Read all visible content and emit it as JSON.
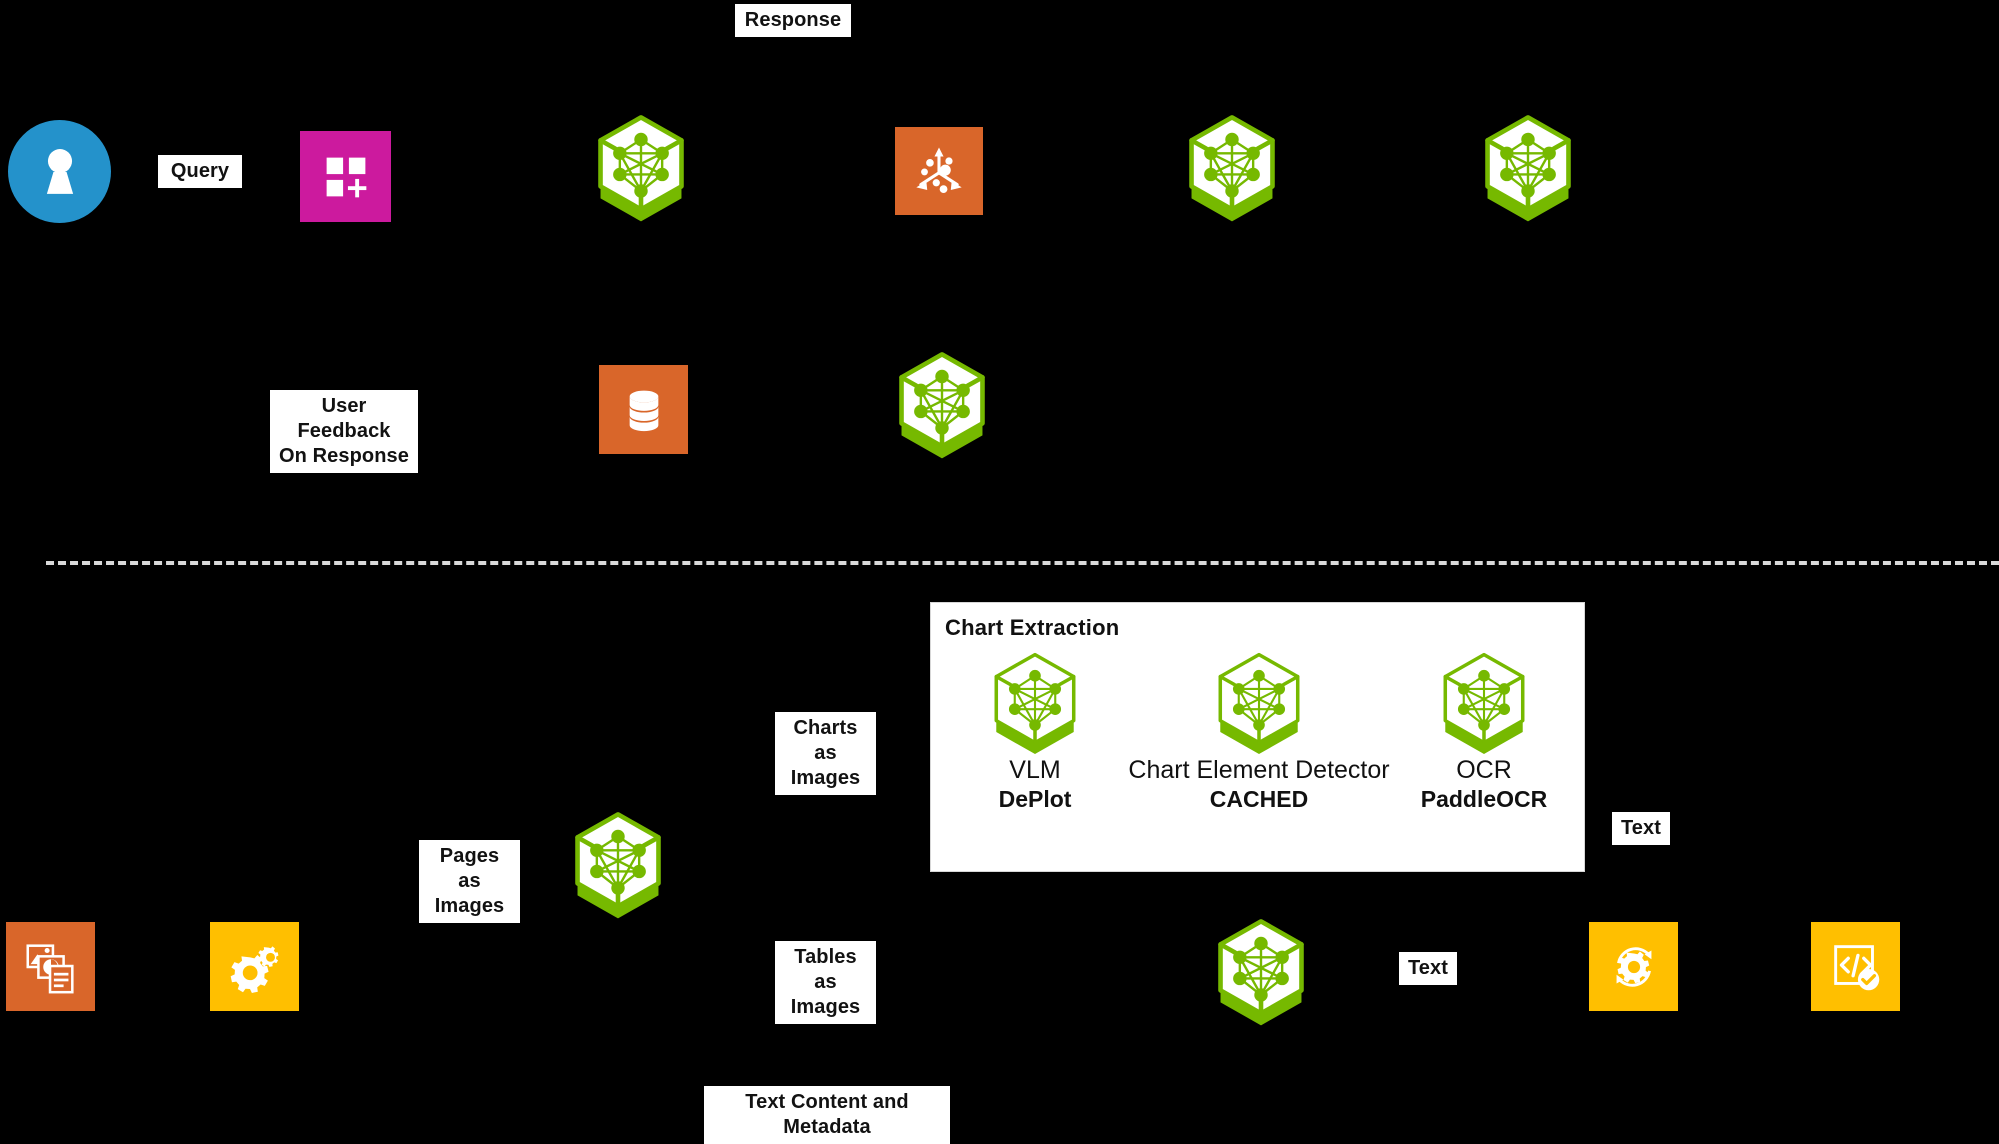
{
  "diagram": {
    "title": "Chart Extraction",
    "background_color": "#000000",
    "colors": {
      "nvidia_green": "#76b900",
      "avatar_blue": "#2492cb",
      "magenta": "#cc1a9e",
      "orange": "#d9662a",
      "amber": "#ffbf00",
      "chip_bg": "#ffffff",
      "chip_text": "#121212",
      "divider": "#d9d9d9"
    }
  },
  "labels": {
    "response": "Response",
    "query": "Query",
    "user_feedback": "User Feedback\nOn Response",
    "charts_as_images": "Charts as\nImages",
    "tables_as_images": "Tables as\nImages",
    "pages_as_images": "Pages as\nImages",
    "text_right_top": "Text",
    "text_right_bottom": "Text",
    "text_content_metadata": "Text Content and Metadata"
  },
  "chart_extraction": {
    "title": "Chart Extraction",
    "items": [
      {
        "icon": "nim-cube-icon",
        "name": "VLM",
        "sub": "DePlot"
      },
      {
        "icon": "nim-cube-icon",
        "name": "Chart Element Detector",
        "sub": "CACHED"
      },
      {
        "icon": "nim-cube-icon",
        "name": "OCR",
        "sub": "PaddleOCR"
      }
    ]
  },
  "icons": {
    "user_avatar": "user-avatar-icon",
    "app_tiles_plus": "app-tiles-plus-icon",
    "nim_cube": "nim-cube-icon",
    "vector_embedding": "vector-embedding-icon",
    "database": "database-icon",
    "documents": "documents-icon",
    "gears": "gears-icon",
    "gear_refresh": "gear-refresh-icon",
    "code_check": "code-check-icon"
  }
}
